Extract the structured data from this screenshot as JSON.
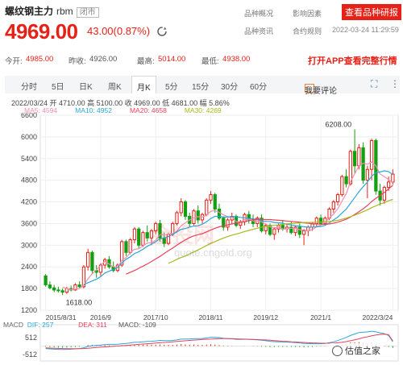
{
  "header": {
    "name": "螺纹钢主力",
    "code": "rbm",
    "market_status": "闭市",
    "price": "4969.00",
    "change": "43.00(0.87%)",
    "links": [
      "品种概况",
      "影响因素",
      "品种资讯",
      "合约规则"
    ],
    "quote_button": "查看品种研报",
    "timestamp": "2022-03-24 11:29:59"
  },
  "stats": {
    "open_label": "今开:",
    "open": "4985.00",
    "prev_label": "昨收:",
    "prev": "4926.00",
    "high_label": "最高:",
    "high": "5014.00",
    "low_label": "最低:",
    "low": "4938.00",
    "app_promo": "打开APP查看完整行情"
  },
  "tabs": {
    "items": [
      "分时",
      "5日",
      "日K",
      "周K",
      "月K",
      "5分",
      "15分",
      "30分",
      "60分"
    ],
    "active": "月K",
    "comment": "我要评论",
    "fullscreen_glyph": "⛶",
    "more_glyph": "⋮"
  },
  "candle_info": "2022/03/24  开 4710.00  高 5100.00  收 4969.00  低 4681.00  幅 5.86%",
  "ma_legend": [
    {
      "label": "MA5: 4594",
      "color": "#f08fb0"
    },
    {
      "label": "MA10: 4952",
      "color": "#2aa7d8"
    },
    {
      "label": "MA20: 4658",
      "color": "#e8425a"
    },
    {
      "label": "MA30: 4269",
      "color": "#a8b81f"
    }
  ],
  "macd_legend": {
    "title": "MACD",
    "dif": "DIF: 257",
    "dea": "DEA: 311",
    "macd": "MACD: -109",
    "title_color": "#666666",
    "dif_color": "#2aa7d8",
    "dea_color": "#e8425a",
    "macd_color": "#555555"
  },
  "watermark": "quote.cngold.org",
  "watermark_logo": "金投网",
  "corner_badge": "估值之家",
  "chart_data": {
    "type": "candlestick",
    "y_ticks": [
      1200,
      1800,
      2400,
      3000,
      3600,
      4200,
      4800,
      5400,
      6000,
      6600
    ],
    "y_tick_labels": [
      "1200",
      "1800",
      "2400",
      "3000",
      "3600",
      "4200",
      "4800",
      "5400",
      "6000",
      "6600"
    ],
    "ylim": [
      1200,
      6600
    ],
    "x_tick_labels": [
      "2015/8/31",
      "2016/9",
      "2017/10",
      "2018/11",
      "2019/12",
      "2021/1",
      "2022/3/24"
    ],
    "annotations": {
      "max": "6208.00",
      "min": "1618.00"
    },
    "macd_ticks": [
      "512",
      "0",
      "-512"
    ],
    "up_color": "#e62117",
    "down_color": "#12a012",
    "candles": [
      [
        2150,
        2200,
        1850,
        1900
      ],
      [
        1900,
        2000,
        1780,
        1820
      ],
      [
        1820,
        1900,
        1700,
        1760
      ],
      [
        1760,
        1850,
        1690,
        1740
      ],
      [
        1740,
        1800,
        1618,
        1700
      ],
      [
        1700,
        1850,
        1650,
        1800
      ],
      [
        1800,
        1880,
        1720,
        1760
      ],
      [
        1760,
        1950,
        1740,
        1900
      ],
      [
        1900,
        2000,
        1820,
        1850
      ],
      [
        1850,
        2450,
        1800,
        2400
      ],
      [
        2400,
        2900,
        2300,
        2800
      ],
      [
        2800,
        2850,
        2200,
        2300
      ],
      [
        2300,
        2450,
        2100,
        2250
      ],
      [
        2250,
        2500,
        2150,
        2450
      ],
      [
        2450,
        2650,
        2350,
        2600
      ],
      [
        2600,
        2700,
        2350,
        2400
      ],
      [
        2400,
        2550,
        2250,
        2300
      ],
      [
        2300,
        2500,
        2250,
        2450
      ],
      [
        2450,
        3150,
        2400,
        3100
      ],
      [
        3100,
        3150,
        2700,
        2800
      ],
      [
        2800,
        3200,
        2750,
        3150
      ],
      [
        3150,
        3500,
        3050,
        3450
      ],
      [
        3450,
        3500,
        2900,
        3000
      ],
      [
        3000,
        3400,
        2950,
        3350
      ],
      [
        3350,
        3550,
        3100,
        3200
      ],
      [
        3200,
        3450,
        3000,
        3400
      ],
      [
        3400,
        3650,
        3300,
        3600
      ],
      [
        3600,
        3700,
        3100,
        3200
      ],
      [
        3200,
        3350,
        2950,
        3050
      ],
      [
        3050,
        3350,
        3000,
        3300
      ],
      [
        3300,
        3650,
        3250,
        3600
      ],
      [
        3600,
        3950,
        3550,
        3900
      ],
      [
        3900,
        4300,
        3800,
        4200
      ],
      [
        4200,
        4250,
        3700,
        3800
      ],
      [
        3800,
        3900,
        3500,
        3600
      ],
      [
        3600,
        4000,
        3550,
        3950
      ],
      [
        3950,
        4100,
        3600,
        3700
      ],
      [
        3700,
        3900,
        3600,
        3850
      ],
      [
        3850,
        4300,
        3800,
        4250
      ],
      [
        4250,
        4500,
        4150,
        4400
      ],
      [
        4400,
        4450,
        3900,
        4000
      ],
      [
        4000,
        4150,
        3700,
        3750
      ],
      [
        3750,
        3800,
        3400,
        3500
      ],
      [
        3500,
        3750,
        3400,
        3700
      ],
      [
        3700,
        3900,
        3600,
        3800
      ],
      [
        3800,
        3850,
        3500,
        3550
      ],
      [
        3550,
        3700,
        3450,
        3650
      ],
      [
        3650,
        3900,
        3550,
        3850
      ],
      [
        3850,
        3950,
        3600,
        3700
      ],
      [
        3700,
        3850,
        3500,
        3600
      ],
      [
        3600,
        3800,
        3500,
        3750
      ],
      [
        3750,
        3850,
        3350,
        3400
      ],
      [
        3400,
        3600,
        3300,
        3550
      ],
      [
        3550,
        3600,
        3250,
        3300
      ],
      [
        3300,
        3500,
        3150,
        3450
      ],
      [
        3450,
        3600,
        3350,
        3550
      ],
      [
        3550,
        3700,
        3400,
        3450
      ],
      [
        3450,
        3600,
        3350,
        3500
      ],
      [
        3500,
        3650,
        3300,
        3350
      ],
      [
        3350,
        3550,
        3250,
        3500
      ],
      [
        3500,
        3600,
        3200,
        3300
      ],
      [
        3300,
        3450,
        3000,
        3400
      ],
      [
        3400,
        3550,
        3250,
        3500
      ],
      [
        3500,
        3650,
        3400,
        3600
      ],
      [
        3600,
        3800,
        3500,
        3750
      ],
      [
        3750,
        3850,
        3550,
        3600
      ],
      [
        3600,
        3800,
        3550,
        3750
      ],
      [
        3750,
        4050,
        3700,
        4000
      ],
      [
        4000,
        4250,
        3900,
        4200
      ],
      [
        4200,
        4450,
        4100,
        4400
      ],
      [
        4400,
        4950,
        4350,
        4900
      ],
      [
        4900,
        5100,
        4600,
        4700
      ],
      [
        4700,
        5650,
        4650,
        5600
      ],
      [
        5600,
        6208,
        5000,
        5200
      ],
      [
        5200,
        5800,
        5100,
        5700
      ],
      [
        5700,
        5850,
        4700,
        4800
      ],
      [
        4800,
        5200,
        4300,
        5100
      ],
      [
        5100,
        5950,
        4800,
        5900
      ],
      [
        5900,
        5950,
        4400,
        4500
      ],
      [
        4500,
        4700,
        4100,
        4250
      ],
      [
        4250,
        4650,
        4150,
        4600
      ],
      [
        4600,
        4900,
        4500,
        4750
      ],
      [
        4750,
        5100,
        4681,
        4969
      ]
    ],
    "series": [
      {
        "name": "MA5",
        "color": "#f08fb0",
        "values": [
          null,
          null,
          null,
          null,
          1840,
          1800,
          1770,
          1780,
          1800,
          1890,
          2070,
          2210,
          2320,
          2440,
          2560,
          2480,
          2400,
          2390,
          2580,
          2660,
          2790,
          2890,
          2900,
          2980,
          3060,
          3070,
          3140,
          3290,
          3290,
          3310,
          3320,
          3390,
          3540,
          3620,
          3700,
          3760,
          3790,
          3780,
          3830,
          3940,
          3960,
          3910,
          3840,
          3790,
          3780,
          3650,
          3640,
          3710,
          3720,
          3670,
          3670,
          3650,
          3580,
          3510,
          3480,
          3500,
          3450,
          3450,
          3470,
          3470,
          3430,
          3420,
          3400,
          3430,
          3510,
          3560,
          3640,
          3750,
          3860,
          4010,
          4220,
          4430,
          4760,
          4980,
          5200,
          5270,
          5240,
          5310,
          5200,
          4970,
          4900,
          4820,
          4730
        ]
      },
      {
        "name": "MA10",
        "color": "#2aa7d8",
        "values": [
          null,
          null,
          null,
          null,
          null,
          null,
          null,
          null,
          null,
          1910,
          1960,
          2010,
          2060,
          2130,
          2230,
          2280,
          2330,
          2380,
          2510,
          2610,
          2680,
          2770,
          2820,
          2890,
          2970,
          3030,
          3100,
          3180,
          3200,
          3240,
          3300,
          3370,
          3440,
          3460,
          3500,
          3530,
          3540,
          3580,
          3650,
          3740,
          3800,
          3800,
          3780,
          3780,
          3790,
          3790,
          3770,
          3760,
          3740,
          3730,
          3710,
          3680,
          3660,
          3660,
          3630,
          3620,
          3610,
          3580,
          3560,
          3540,
          3530,
          3510,
          3500,
          3500,
          3510,
          3520,
          3550,
          3620,
          3700,
          3780,
          3890,
          4000,
          4160,
          4320,
          4480,
          4620,
          4750,
          4910,
          5010,
          5030,
          5060,
          5040,
          4952
        ]
      },
      {
        "name": "MA20",
        "color": "#e8425a",
        "values": [
          null,
          null,
          null,
          null,
          null,
          null,
          null,
          null,
          null,
          null,
          null,
          null,
          null,
          null,
          null,
          null,
          null,
          null,
          null,
          2200,
          2250,
          2300,
          2360,
          2420,
          2480,
          2550,
          2620,
          2690,
          2770,
          2850,
          2920,
          3000,
          3080,
          3150,
          3210,
          3260,
          3290,
          3320,
          3370,
          3420,
          3470,
          3510,
          3540,
          3560,
          3590,
          3610,
          3630,
          3650,
          3680,
          3710,
          3720,
          3720,
          3710,
          3710,
          3700,
          3690,
          3680,
          3670,
          3660,
          3650,
          3640,
          3620,
          3610,
          3590,
          3590,
          3580,
          3580,
          3590,
          3610,
          3640,
          3680,
          3720,
          3780,
          3850,
          3930,
          4010,
          4100,
          4210,
          4300,
          4380,
          4460,
          4560,
          4658
        ]
      },
      {
        "name": "MA30",
        "color": "#a8b81f",
        "values": [
          null,
          null,
          null,
          null,
          null,
          null,
          null,
          null,
          null,
          null,
          null,
          null,
          null,
          null,
          null,
          null,
          null,
          null,
          null,
          null,
          null,
          null,
          null,
          null,
          null,
          null,
          null,
          null,
          null,
          2500,
          2550,
          2610,
          2660,
          2700,
          2760,
          2810,
          2870,
          2930,
          2990,
          3050,
          3100,
          3150,
          3200,
          3240,
          3280,
          3310,
          3340,
          3380,
          3410,
          3440,
          3470,
          3500,
          3520,
          3540,
          3550,
          3560,
          3580,
          3590,
          3600,
          3610,
          3620,
          3630,
          3630,
          3630,
          3640,
          3640,
          3650,
          3660,
          3670,
          3690,
          3720,
          3750,
          3790,
          3830,
          3880,
          3930,
          3980,
          4040,
          4090,
          4140,
          4180,
          4230,
          4269
        ]
      }
    ],
    "macd_bars": [
      -40,
      -60,
      -80,
      -90,
      -100,
      -90,
      -80,
      -60,
      -40,
      0,
      60,
      70,
      60,
      50,
      60,
      40,
      20,
      10,
      60,
      50,
      70,
      90,
      70,
      80,
      90,
      80,
      90,
      100,
      80,
      70,
      70,
      90,
      120,
      100,
      80,
      90,
      70,
      70,
      90,
      110,
      90,
      60,
      30,
      20,
      20,
      -10,
      -10,
      10,
      0,
      -20,
      -20,
      -40,
      -50,
      -60,
      -60,
      -50,
      -50,
      -50,
      -50,
      -60,
      -60,
      -70,
      -60,
      -50,
      -30,
      -30,
      -10,
      20,
      50,
      90,
      140,
      160,
      220,
      220,
      240,
      180,
      160,
      180,
      90,
      40,
      20,
      -60,
      -109
    ],
    "macd_dif": [
      -150,
      -170,
      -190,
      -200,
      -210,
      -200,
      -190,
      -170,
      -150,
      -100,
      -20,
      20,
      40,
      60,
      90,
      100,
      100,
      100,
      140,
      160,
      190,
      230,
      240,
      260,
      280,
      290,
      310,
      340,
      330,
      330,
      340,
      370,
      420,
      430,
      430,
      450,
      450,
      460,
      490,
      530,
      530,
      510,
      470,
      450,
      440,
      410,
      400,
      410,
      410,
      390,
      380,
      350,
      320,
      290,
      270,
      260,
      250,
      240,
      230,
      210,
      190,
      160,
      150,
      140,
      140,
      140,
      160,
      200,
      260,
      330,
      430,
      520,
      640,
      730,
      820,
      840,
      860,
      900,
      860,
      800,
      750,
      640,
      257
    ],
    "macd_dea": [
      -110,
      -120,
      -130,
      -140,
      -150,
      -160,
      -160,
      -160,
      -160,
      -150,
      -130,
      -110,
      -90,
      -70,
      -50,
      -30,
      -10,
      0,
      20,
      40,
      60,
      80,
      100,
      120,
      140,
      160,
      180,
      200,
      220,
      240,
      260,
      280,
      300,
      320,
      340,
      360,
      380,
      400,
      410,
      420,
      440,
      450,
      450,
      450,
      450,
      440,
      430,
      420,
      410,
      400,
      390,
      380,
      370,
      350,
      330,
      310,
      290,
      280,
      260,
      250,
      230,
      220,
      200,
      190,
      180,
      170,
      170,
      170,
      180,
      200,
      230,
      270,
      320,
      380,
      440,
      510,
      560,
      620,
      670,
      700,
      720,
      690,
      311
    ]
  }
}
